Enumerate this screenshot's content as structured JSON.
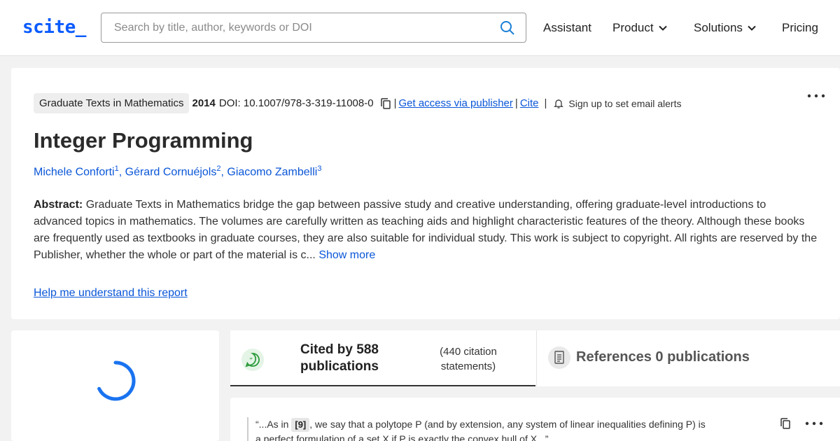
{
  "header": {
    "logo": "scite_",
    "search_placeholder": "Search by title, author, keywords or DOI",
    "nav": [
      {
        "label": "Assistant"
      },
      {
        "label": "Product"
      },
      {
        "label": "Solutions"
      },
      {
        "label": "Pricing"
      }
    ]
  },
  "paper": {
    "journal": "Graduate Texts in Mathematics",
    "year": "2014",
    "doi": "DOI: 10.1007/978-3-319-11008-0",
    "access_link": "Get access via publisher",
    "cite_link": "Cite",
    "alert_text": "Sign up to set email alerts",
    "title": "Integer Programming",
    "authors": [
      {
        "name": "Michele Conforti",
        "sup": "1"
      },
      {
        "name": "Gérard Cornuéjols",
        "sup": "2"
      },
      {
        "name": "Giacomo Zambelli",
        "sup": "3"
      }
    ],
    "abstract_label": "Abstract:",
    "abstract": "Graduate Texts in Mathematics bridge the gap between passive study and creative understanding, offering graduate-level introductions to advanced topics in mathematics. The volumes are carefully written as teaching aids and highlight characteristic features of the theory. Although these books are frequently used as textbooks in graduate courses, they are also suitable for individual study. This work is subject to copyright. All rights are reserved by the Publisher, whether the whole or part of the material is c...",
    "show_more": "Show more",
    "help_link": "Help me understand this report"
  },
  "tabs": {
    "cited_title": "Cited by 588 publications",
    "cited_sub": "(440 citation statements)",
    "refs_title": "References 0 publications"
  },
  "citation": {
    "prefix": "“...As in",
    "ref": "[9]",
    "text": ", we say that a polytope P (and by extension, any system of linear inequalities defining P) is a perfect formulation of a set X if P is exactly the convex hull of X...”"
  },
  "colors": {
    "accent": "#0a5bff",
    "link": "#0a56d8"
  }
}
